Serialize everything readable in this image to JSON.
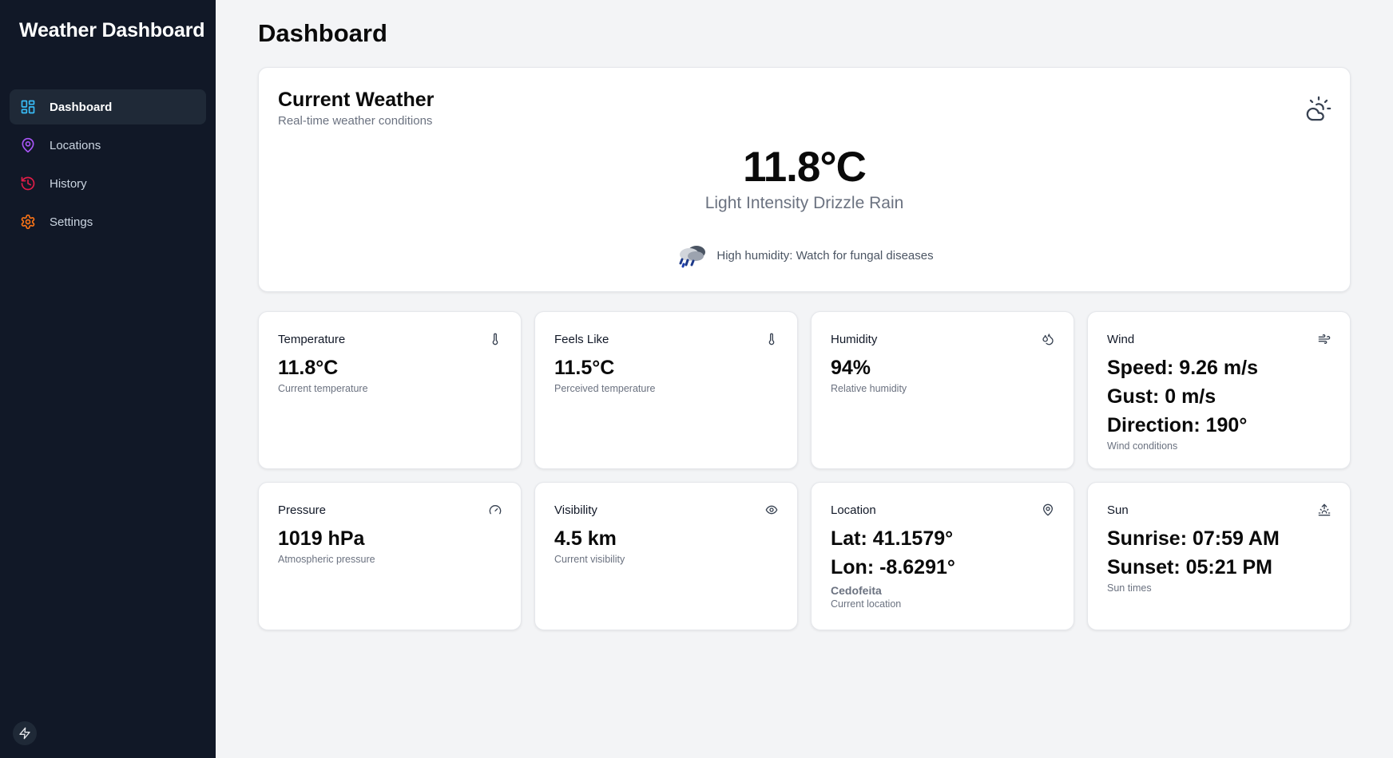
{
  "sidebar": {
    "brand": "Weather Dashboard",
    "items": [
      {
        "label": "Dashboard",
        "icon": "grid-icon",
        "color": "#38bdf8",
        "active": true
      },
      {
        "label": "Locations",
        "icon": "map-pin-icon",
        "color": "#a855f7"
      },
      {
        "label": "History",
        "icon": "history-icon",
        "color": "#e11d48"
      },
      {
        "label": "Settings",
        "icon": "gear-icon",
        "color": "#f97316"
      }
    ],
    "footer_icon": "bolt-icon"
  },
  "page": {
    "title": "Dashboard"
  },
  "current": {
    "title": "Current Weather",
    "subtitle": "Real-time weather conditions",
    "icon": "cloud-sun-icon",
    "temperature": "11.8°C",
    "description": "Light Intensity Drizzle Rain",
    "alert_icon": "rain-cloud-icon",
    "alert": "High humidity: Watch for fungal diseases"
  },
  "metrics": {
    "temperature": {
      "label": "Temperature",
      "icon": "thermometer-icon",
      "value": "11.8°C",
      "caption": "Current temperature"
    },
    "feels_like": {
      "label": "Feels Like",
      "icon": "thermometer-icon",
      "value": "11.5°C",
      "caption": "Perceived temperature"
    },
    "humidity": {
      "label": "Humidity",
      "icon": "droplets-icon",
      "value": "94%",
      "caption": "Relative humidity"
    },
    "wind": {
      "label": "Wind",
      "icon": "wind-icon",
      "speed": "Speed: 9.26 m/s",
      "gust": "Gust: 0 m/s",
      "direction": "Direction: 190°",
      "caption": "Wind conditions"
    },
    "pressure": {
      "label": "Pressure",
      "icon": "gauge-icon",
      "value": "1019 hPa",
      "caption": "Atmospheric pressure"
    },
    "visibility": {
      "label": "Visibility",
      "icon": "eye-icon",
      "value": "4.5 km",
      "caption": "Current visibility"
    },
    "location": {
      "label": "Location",
      "icon": "map-pin-icon",
      "lat": "Lat: 41.1579°",
      "lon": "Lon: -8.6291°",
      "place": "Cedofeita",
      "caption": "Current location"
    },
    "sun": {
      "label": "Sun",
      "icon": "sunrise-icon",
      "sunrise": "Sunrise: 07:59 AM",
      "sunset": "Sunset: 05:21 PM",
      "caption": "Sun times"
    }
  }
}
